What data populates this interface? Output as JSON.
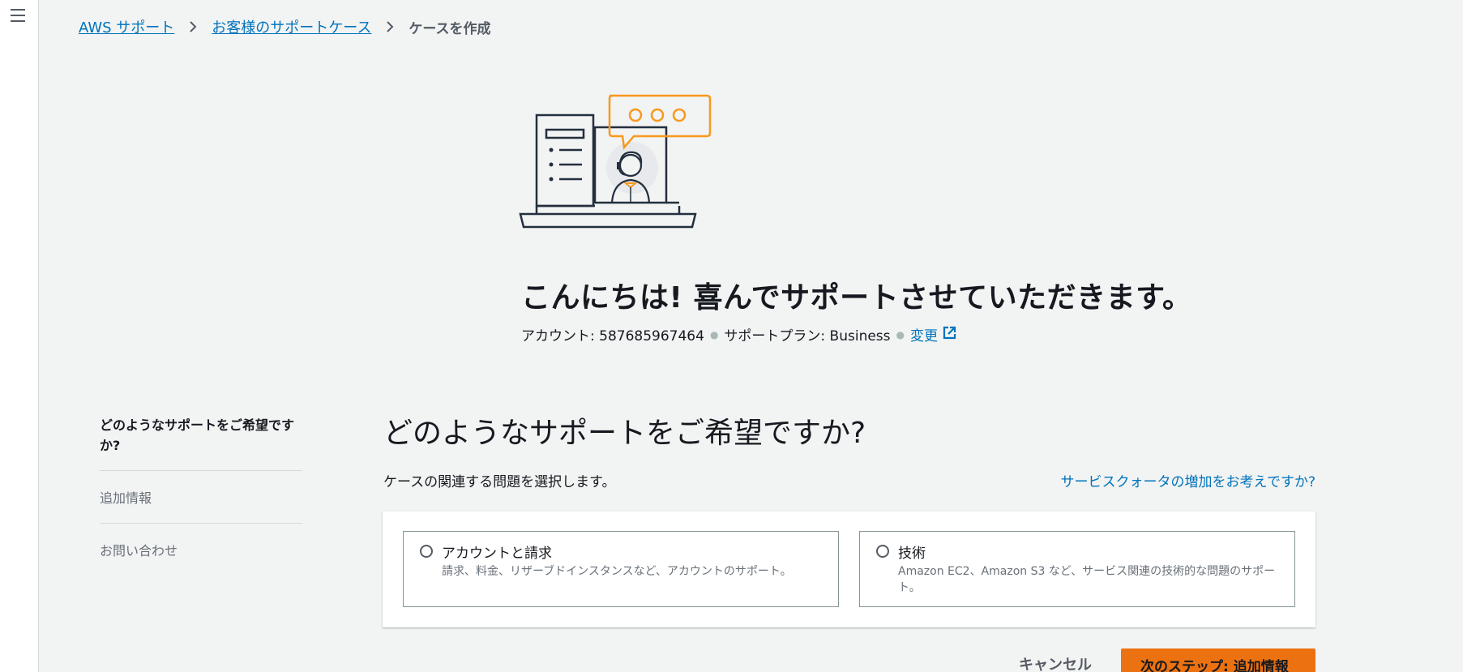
{
  "breadcrumb": {
    "items": [
      "AWS サポート",
      "お客様のサポートケース"
    ],
    "current": "ケースを作成"
  },
  "hero": {
    "title": "こんにちは! 喜んでサポートさせていただきます。",
    "account_label": "アカウント: 587685967464",
    "plan_label": "サポートプラン: Business",
    "change_link": "変更"
  },
  "side_nav": {
    "active": "どのようなサポートをご希望ですか?",
    "items": [
      "追加情報",
      "お問い合わせ"
    ]
  },
  "main": {
    "title": "どのようなサポートをご希望ですか?",
    "description": "ケースの関連する問題を選択します。",
    "quota_link": "サービスクォータの増加をお考えですか?",
    "options": [
      {
        "label": "アカウントと請求",
        "hint": "請求、料金、リザーブドインスタンスなど、アカウントのサポート。"
      },
      {
        "label": "技術",
        "hint": "Amazon EC2、Amazon S3 など、サービス関連の技術的な問題のサポート。"
      }
    ]
  },
  "footer": {
    "cancel": "キャンセル",
    "next": "次のステップ: 追加情報"
  },
  "colors": {
    "link": "#0073bb",
    "primary": "#ec7211",
    "accent_illustration": "#f8991d"
  },
  "icons": [
    "menu-icon",
    "chevron-right-icon",
    "external-link-icon",
    "support-agent-illustration"
  ]
}
